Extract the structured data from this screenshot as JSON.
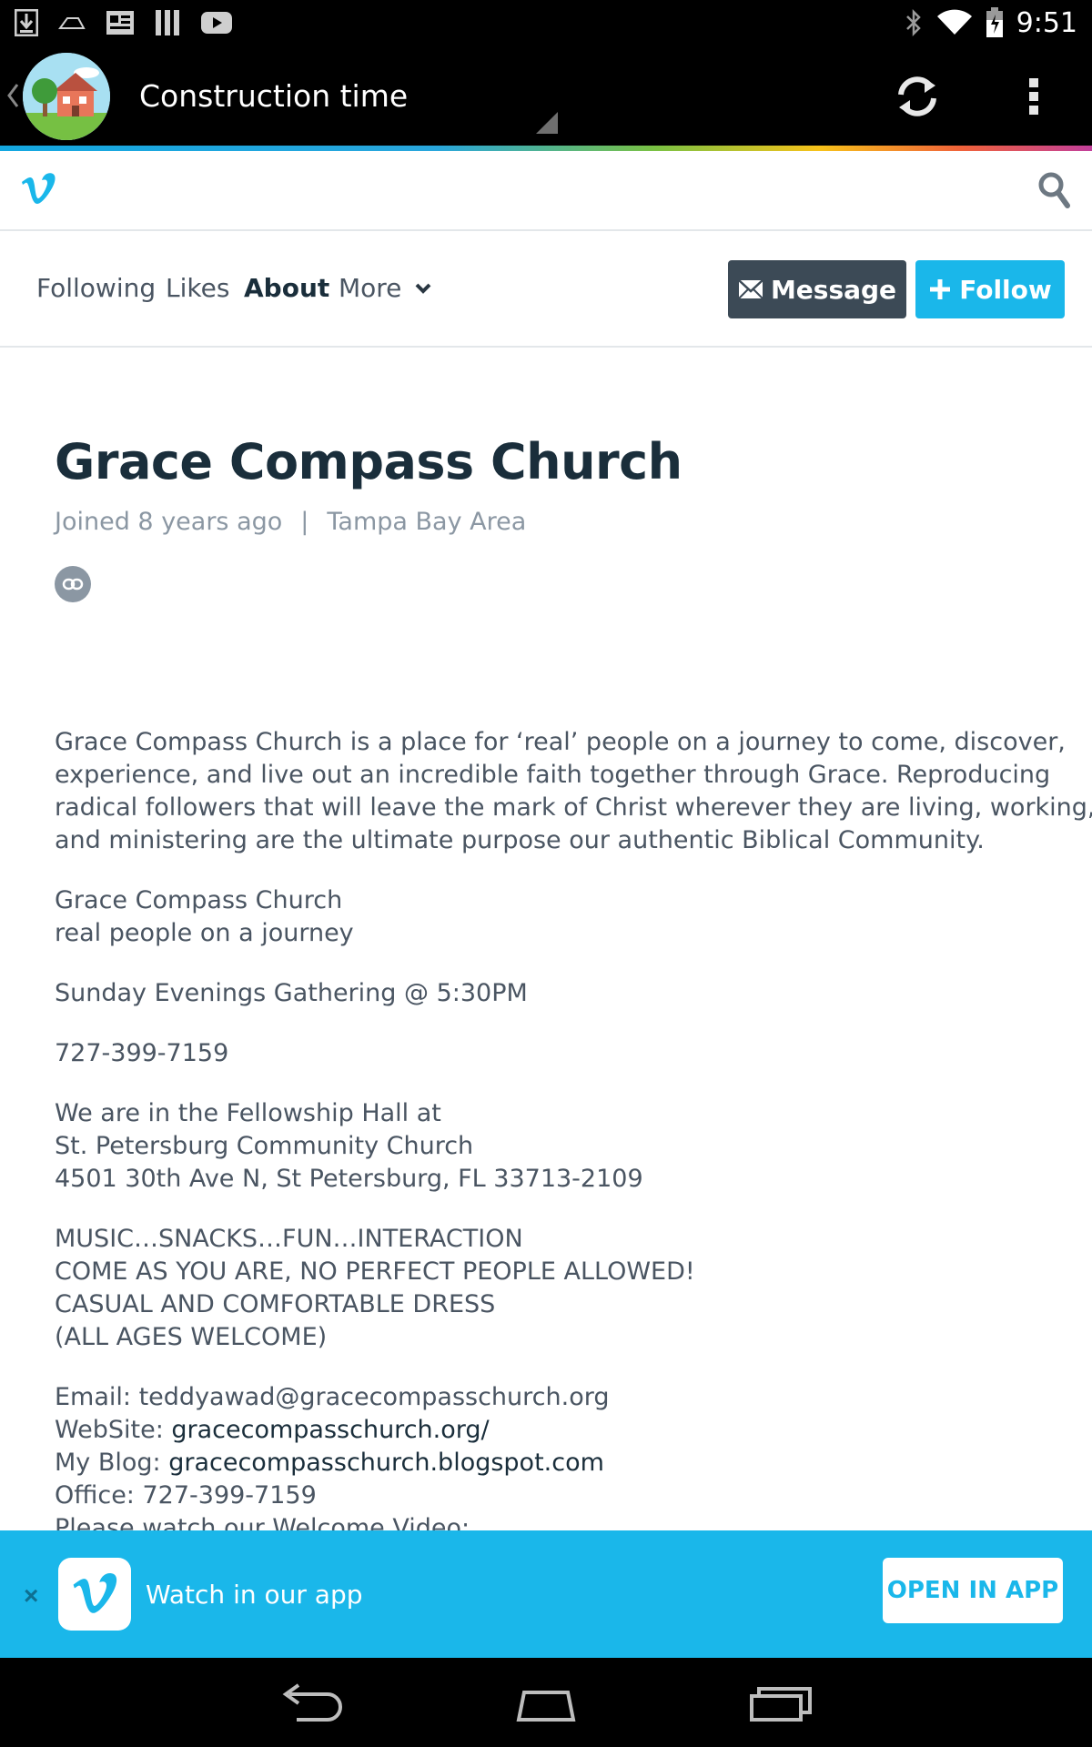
{
  "status_bar": {
    "time": "9:51",
    "left_icons": [
      "download-icon",
      "speed-icon",
      "news-icon",
      "library-icon",
      "youtube-icon"
    ],
    "right_icons": [
      "bluetooth-icon",
      "wifi-icon",
      "battery-icon"
    ]
  },
  "action_bar": {
    "title": "Construction time",
    "icons": [
      "back-chevron-icon",
      "house-avatar",
      "refresh-icon",
      "overflow-menu-icon"
    ]
  },
  "vimeo_header": {
    "icons": [
      "vimeo-logo-icon",
      "search-icon"
    ]
  },
  "subnav": {
    "items": [
      {
        "label": "Following"
      },
      {
        "label": "Likes"
      },
      {
        "label": "About",
        "active": true
      },
      {
        "label": "More"
      }
    ],
    "message_label": "Message",
    "follow_label": "Follow"
  },
  "profile": {
    "name": "Grace Compass Church",
    "joined": "Joined 8 years ago",
    "separator": "|",
    "location": "Tampa Bay Area"
  },
  "bio": {
    "para1": [
      "Grace Compass Church is a place for ‘real’ people on a journey to come, discover,",
      "experience, and live out an incredible faith together through Grace. Reproducing",
      "radical followers that will leave the mark of Christ wherever they are living, working,",
      "and ministering are the ultimate purpose our authentic Biblical Community."
    ],
    "para2": [
      "Grace Compass Church",
      "real people on a journey"
    ],
    "para3": [
      "Sunday Evenings Gathering @ 5:30PM"
    ],
    "para4": [
      "727-399-7159"
    ],
    "para5": [
      "We are in the Fellowship Hall at",
      "St. Petersburg Community Church",
      "4501 30th Ave N, St Petersburg, FL 33713-2109"
    ],
    "para6": [
      "MUSIC…SNACKS…FUN…INTERACTION",
      "COME AS YOU ARE, NO PERFECT PEOPLE ALLOWED!",
      "CASUAL AND COMFORTABLE DRESS",
      "(ALL AGES WELCOME)"
    ],
    "contact": {
      "email": "Email: teddyawad@gracecompasschurch.org",
      "website_prefix": "WebSite: ",
      "website_link": "gracecompasschurch.org/",
      "blog_prefix": "My Blog: ",
      "blog_link": "gracecompasschurch.blogspot.com",
      "office": "Office: 727-399-7159",
      "video": "Please watch our Welcome Video:"
    }
  },
  "app_banner": {
    "close": "×",
    "text": "Watch in our app",
    "button": "OPEN IN APP"
  },
  "colors": {
    "vimeo_blue": "#1ab7ea",
    "message_button": "#3c4a56",
    "heading": "#1a2e3b",
    "body_text": "#4a5562",
    "muted_text": "#8b97a3"
  },
  "nav_bar": {
    "icons": [
      "back-icon",
      "home-icon",
      "recents-icon"
    ]
  }
}
